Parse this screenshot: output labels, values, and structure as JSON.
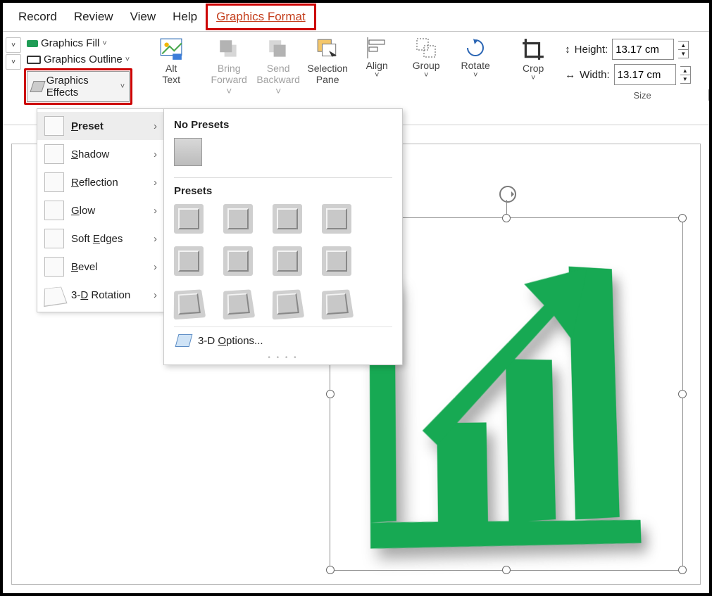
{
  "tabs": {
    "record": "Record",
    "review": "Review",
    "view": "View",
    "help": "Help",
    "graphics_format": "Graphics Format"
  },
  "gfx": {
    "fill": "Graphics Fill",
    "outline": "Graphics Outline",
    "effects": "Graphics Effects"
  },
  "ribbon": {
    "alt1": "Alt",
    "alt2": "Text",
    "bring1": "Bring",
    "bring2": "Forward",
    "send1": "Send",
    "send2": "Backward",
    "selpane1": "Selection",
    "selpane2": "Pane",
    "align": "Align",
    "group": "Group",
    "rotate": "Rotate",
    "crop": "Crop"
  },
  "size": {
    "height_lbl": "Height:",
    "height_val": "13.17 cm",
    "width_lbl": "Width:",
    "width_val": "13.17 cm",
    "group": "Size"
  },
  "effects_menu": {
    "preset": "Preset",
    "shadow": "Shadow",
    "reflection": "Reflection",
    "glow": "Glow",
    "soft_edges": "Soft Edges",
    "bevel": "Bevel",
    "rotation3d": "3-D Rotation"
  },
  "fly": {
    "no_presets": "No Presets",
    "presets": "Presets",
    "options": "3-D Options..."
  },
  "graphic": {
    "color": "#179a53"
  }
}
